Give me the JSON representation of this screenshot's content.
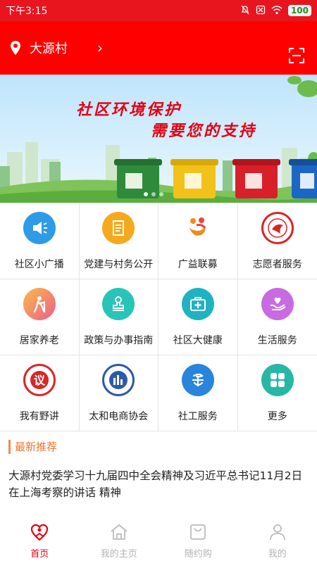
{
  "status_bar": {
    "time": "下午3:15",
    "battery": "100"
  },
  "header": {
    "location": "大源村",
    "chevron": "›"
  },
  "banner": {
    "line1": "社区环境保护",
    "line2": "需要您的支持"
  },
  "grid": {
    "items": [
      {
        "label": "社区小广播",
        "icon": "broadcast-icon"
      },
      {
        "label": "党建与村务公开",
        "icon": "document-icon"
      },
      {
        "label": "广益联募",
        "icon": "charity-icon"
      },
      {
        "label": "志愿者服务",
        "icon": "volunteer-icon"
      },
      {
        "label": "居家养老",
        "icon": "elderly-icon"
      },
      {
        "label": "政策与办事指南",
        "icon": "stamp-icon"
      },
      {
        "label": "社区大健康",
        "icon": "medical-kit-icon"
      },
      {
        "label": "生活服务",
        "icon": "heart-hand-icon"
      },
      {
        "label": "我有野讲",
        "icon": "speak-badge-icon"
      },
      {
        "label": "太和电商协会",
        "icon": "association-icon"
      },
      {
        "label": "社工服务",
        "icon": "social-work-icon"
      },
      {
        "label": "更多",
        "icon": "more-icon"
      }
    ]
  },
  "latest": {
    "title": "最新推荐",
    "article": "大源村党委学习十九届四中全会精神及习近平总书记11月2日在上海考察的讲话 精神"
  },
  "tabbar": {
    "tabs": [
      {
        "label": "首页",
        "icon": "home-heart-icon",
        "active": true
      },
      {
        "label": "我的主页",
        "icon": "house-icon",
        "active": false
      },
      {
        "label": "随约购",
        "icon": "shopping-bag-icon",
        "active": false
      },
      {
        "label": "我的",
        "icon": "person-icon",
        "active": false
      }
    ]
  },
  "colors": {
    "header": "#ff0000",
    "status": "#e8151f",
    "accent": "#e60012",
    "section": "#f0732a"
  }
}
